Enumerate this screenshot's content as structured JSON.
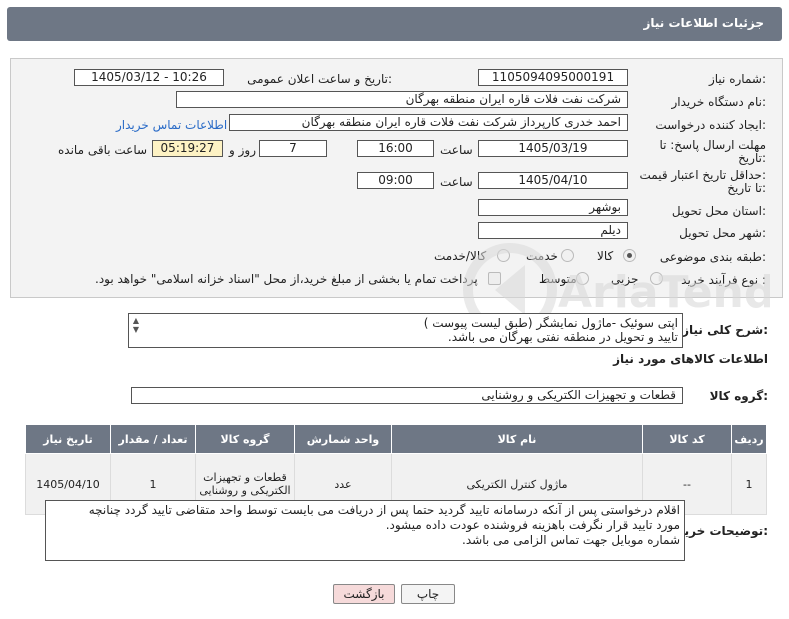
{
  "header": {
    "title": "جزئیات اطلاعات نیاز"
  },
  "form": {
    "need_number_label": "شماره نیاز:",
    "need_number": "1105094095000191",
    "announce_label": "تاریخ و ساعت اعلان عمومی:",
    "announce_value": "1405/03/12 - 10:26",
    "buyer_org_label": "نام دستگاه خریدار:",
    "buyer_org": "شرکت نفت فلات قاره ایران منطقه بهرگان",
    "requester_label": "ایجاد کننده درخواست:",
    "requester": "احمد خدری کارپرداز شرکت نفت فلات قاره ایران منطقه بهرگان",
    "contact_link": "اطلاعات تماس خریدار",
    "deadline_label_1": "مهلت ارسال پاسخ: تا",
    "deadline_label_2": "تاریخ:",
    "deadline_date": "1405/03/19",
    "hour_label": "ساعت",
    "deadline_hour": "16:00",
    "days_value": "7",
    "days_label": "روز و",
    "remaining_time": "05:19:27",
    "remaining_label": "ساعت باقی مانده",
    "validity_label_1": "حداقل تاریخ اعتبار قیمت:",
    "validity_label_2": "تا تاریخ:",
    "validity_date": "1405/04/10",
    "validity_hour": "09:00",
    "province_label": "استان محل تحویل:",
    "province": "بوشهر",
    "city_label": "شهر محل تحویل:",
    "city": "دیلم",
    "category_label": "طبقه بندی موضوعی:",
    "category_options": [
      "کالا",
      "خدمت",
      "کالا/خدمت"
    ],
    "process_label": "نوع فرآیند خرید :",
    "process_options": [
      "جزیی",
      "متوسط"
    ],
    "payment_note": "پرداخت تمام یا بخشی از مبلغ خرید،از محل \"اسناد خزانه اسلامی\" خواهد بود."
  },
  "summary": {
    "label": "شرح کلی نیاز:",
    "lines": [
      "اپتی سوئیک -ماژول نمایشگر (طبق لیست پیوست )",
      "تایید و تحویل در منطقه نفتی بهرگان می باشد."
    ]
  },
  "goods_info_title": "اطلاعات کالاهای مورد نیاز",
  "goods_group_label": "گروه کالا:",
  "goods_group": "قطعات و تجهیزات الکتریکی و روشنایی",
  "table": {
    "headers": [
      "ردیف",
      "کد کالا",
      "نام کالا",
      "واحد شمارش",
      "گروه کالا",
      "تعداد / مقدار",
      "تاریخ نیاز"
    ],
    "rows": [
      [
        "1",
        "--",
        "ماژول کنترل الکتریکی",
        "عدد",
        "قطعات و تجهیزات الکتریکی و روشنایی",
        "1",
        "1405/04/10"
      ]
    ]
  },
  "buyer_notes": {
    "label": "توضیحات خریدار:",
    "lines": [
      "اقلام درخواستی پس از آنکه درسامانه تایید گردید حتما پس از دریافت می بایست توسط واحد متقاضی تایید گردد چنانچه",
      "مورد تایید قرار نگرفت باهزینه فروشنده عودت داده میشود.",
      "شماره موبایل جهت تماس الزامی می باشد."
    ]
  },
  "buttons": {
    "print": "چاپ",
    "back": "بازگشت"
  },
  "watermark": "AriaTender.net",
  "colors": {
    "header_bg": "#6e7785",
    "link": "#2a6bc7",
    "highlight": "#fdf2c4",
    "back_btn": "#f6dada"
  }
}
